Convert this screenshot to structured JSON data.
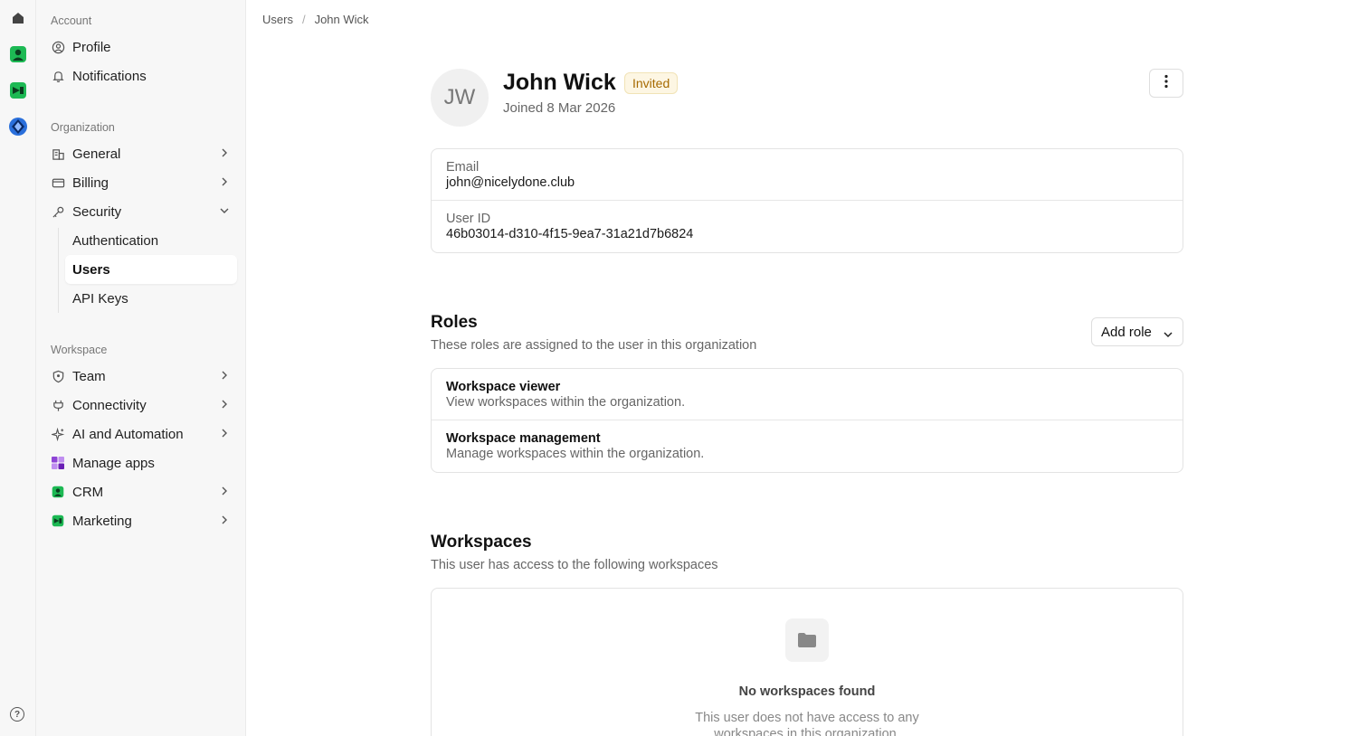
{
  "rail": {
    "apps": [
      "home-icon",
      "crm-app-icon",
      "marketing-app-icon",
      "platform-app-icon"
    ],
    "help_label": "?"
  },
  "sidebar": {
    "account_label": "Account",
    "account_items": [
      {
        "label": "Profile",
        "icon": "user-circle-icon"
      },
      {
        "label": "Notifications",
        "icon": "bell-icon"
      }
    ],
    "organization_label": "Organization",
    "organization_items": [
      {
        "label": "General",
        "icon": "building-icon"
      },
      {
        "label": "Billing",
        "icon": "credit-card-icon"
      },
      {
        "label": "Security",
        "icon": "key-icon",
        "expanded": true
      }
    ],
    "security_subitems": [
      "Authentication",
      "Users",
      "API Keys"
    ],
    "active_subitem": "Users",
    "workspace_label": "Workspace",
    "workspace_items": [
      {
        "label": "Team",
        "icon": "shield-icon"
      },
      {
        "label": "Connectivity",
        "icon": "plug-icon"
      },
      {
        "label": "AI and Automation",
        "icon": "sparkle-icon"
      },
      {
        "label": "Manage apps",
        "icon": "apps-grid-icon"
      },
      {
        "label": "CRM",
        "icon": "crm-app-icon"
      },
      {
        "label": "Marketing",
        "icon": "marketing-app-icon"
      }
    ]
  },
  "breadcrumb": {
    "parent": "Users",
    "separator": "/",
    "current": "John Wick"
  },
  "user": {
    "initials": "JW",
    "name": "John Wick",
    "status": "Invited",
    "joined": "Joined 8 Mar 2026",
    "email_label": "Email",
    "email": "john@nicelydone.club",
    "id_label": "User ID",
    "id": "46b03014-d310-4f15-9ea7-31a21d7b6824"
  },
  "roles": {
    "title": "Roles",
    "subtitle": "These roles are assigned to the user in this organization",
    "add_button": "Add role",
    "items": [
      {
        "title": "Workspace viewer",
        "desc": "View workspaces within the organization."
      },
      {
        "title": "Workspace management",
        "desc": "Manage workspaces within the organization."
      }
    ]
  },
  "workspaces": {
    "title": "Workspaces",
    "subtitle": "This user has access to the following workspaces",
    "empty_title": "No workspaces found",
    "empty_desc": "This user does not have access to any workspaces in this organization."
  },
  "colors": {
    "badge_bg": "#fdf6e3",
    "badge_text": "#a66a00",
    "crm_green": "#1db954",
    "platform_blue": "#2a6fdb"
  }
}
